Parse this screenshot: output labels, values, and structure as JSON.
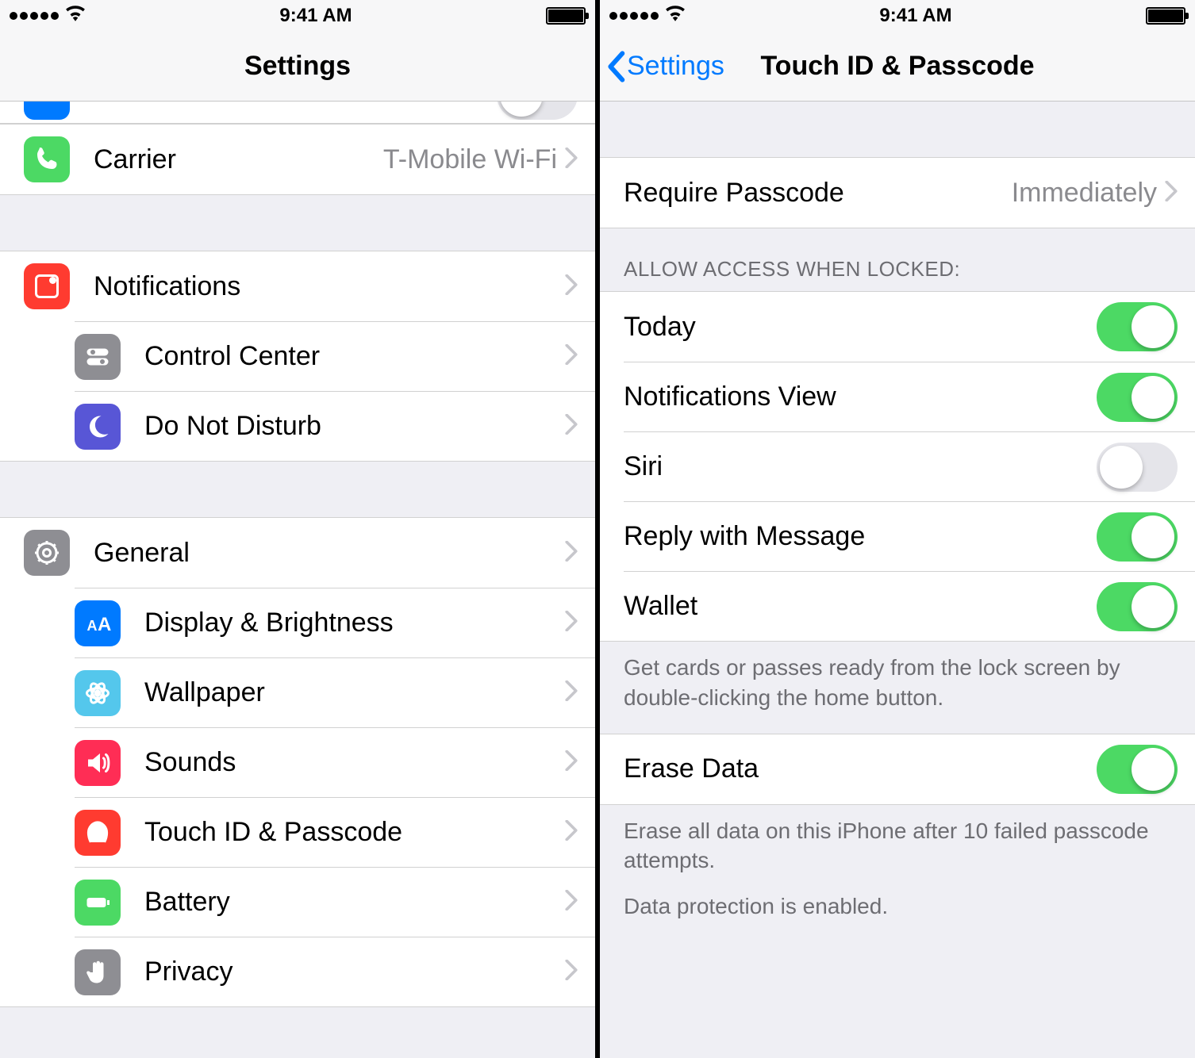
{
  "status": {
    "time": "9:41 AM"
  },
  "left": {
    "nav_title": "Settings",
    "rows": {
      "carrier": {
        "label": "Carrier",
        "value": "T-Mobile Wi-Fi"
      },
      "notifications": "Notifications",
      "control_center": "Control Center",
      "dnd": "Do Not Disturb",
      "general": "General",
      "display": "Display & Brightness",
      "wallpaper": "Wallpaper",
      "sounds": "Sounds",
      "touchid": "Touch ID & Passcode",
      "battery": "Battery",
      "privacy": "Privacy"
    }
  },
  "right": {
    "nav_back": "Settings",
    "nav_title": "Touch ID & Passcode",
    "require_passcode": {
      "label": "Require Passcode",
      "value": "Immediately"
    },
    "section_allow_header": "ALLOW ACCESS WHEN LOCKED:",
    "toggles": {
      "today": {
        "label": "Today",
        "on": true
      },
      "notif": {
        "label": "Notifications View",
        "on": true
      },
      "siri": {
        "label": "Siri",
        "on": false
      },
      "reply": {
        "label": "Reply with Message",
        "on": true
      },
      "wallet": {
        "label": "Wallet",
        "on": true
      }
    },
    "wallet_footer": "Get cards or passes ready from the lock screen by double-clicking the home button.",
    "erase": {
      "label": "Erase Data",
      "on": true
    },
    "erase_footer1": "Erase all data on this iPhone after 10 failed passcode attempts.",
    "erase_footer2": "Data protection is enabled."
  }
}
